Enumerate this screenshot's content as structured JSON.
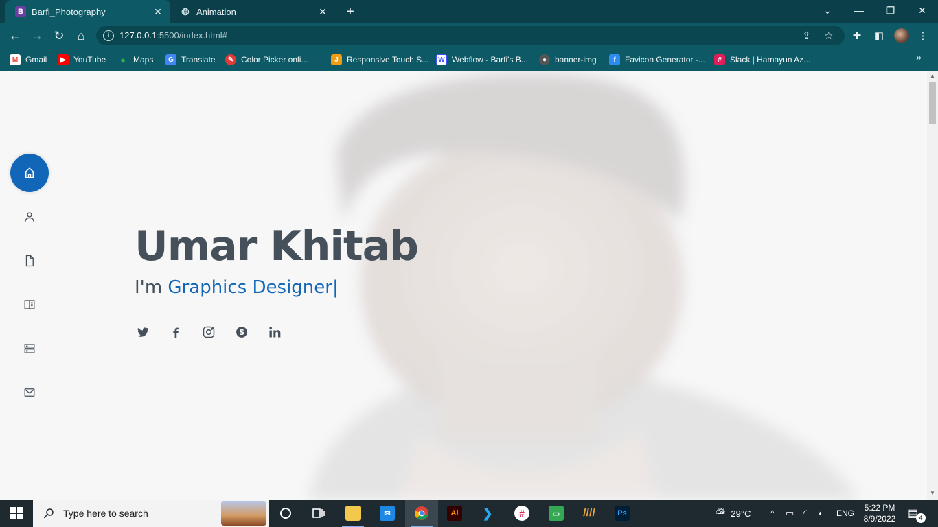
{
  "browser": {
    "tabs": [
      {
        "favicon": "B",
        "title": "Barfi_Photography"
      },
      {
        "favicon": "globe-icon",
        "title": "Animation"
      }
    ],
    "url_host": "127.0.0.1",
    "url_path": ":5500/index.html#",
    "bookmarks": [
      {
        "label": "Gmail",
        "color": "#ea4335",
        "glyph": "M"
      },
      {
        "label": "YouTube",
        "color": "#ff0000",
        "glyph": "▶"
      },
      {
        "label": "Maps",
        "color": "#34a853",
        "glyph": "●"
      },
      {
        "label": "Translate",
        "color": "#4285f4",
        "glyph": "G"
      },
      {
        "label": "Color Picker onli...",
        "color": "#e53935",
        "glyph": "✎"
      },
      {
        "label": "Responsive Touch S...",
        "color": "#f39c12",
        "glyph": "J"
      },
      {
        "label": "Webflow - Barfi's B...",
        "color": "#4353ff",
        "glyph": "W"
      },
      {
        "label": "banner-img",
        "color": "#555555",
        "glyph": "●"
      },
      {
        "label": "Favicon Generator -...",
        "color": "#2d8cf0",
        "glyph": "f"
      },
      {
        "label": "Slack | Hamayun Az...",
        "color": "#e01e5a",
        "glyph": "#"
      }
    ]
  },
  "page": {
    "name": "Umar Khitab",
    "intro": "I'm ",
    "role": "Graphics Designer",
    "caret": "|",
    "nav": [
      "home-icon",
      "person-icon",
      "file-icon",
      "book-icon",
      "server-icon",
      "envelope-icon"
    ],
    "socials": [
      "twitter-icon",
      "facebook-icon",
      "instagram-icon",
      "skype-icon",
      "linkedin-icon"
    ],
    "accent": "#1166b8",
    "text_color": "#45505b"
  },
  "taskbar": {
    "search_placeholder": "Type here to search",
    "weather": "29°C",
    "language": "ENG",
    "time": "5:22 PM",
    "date": "8/9/2022",
    "notifications": "4"
  }
}
